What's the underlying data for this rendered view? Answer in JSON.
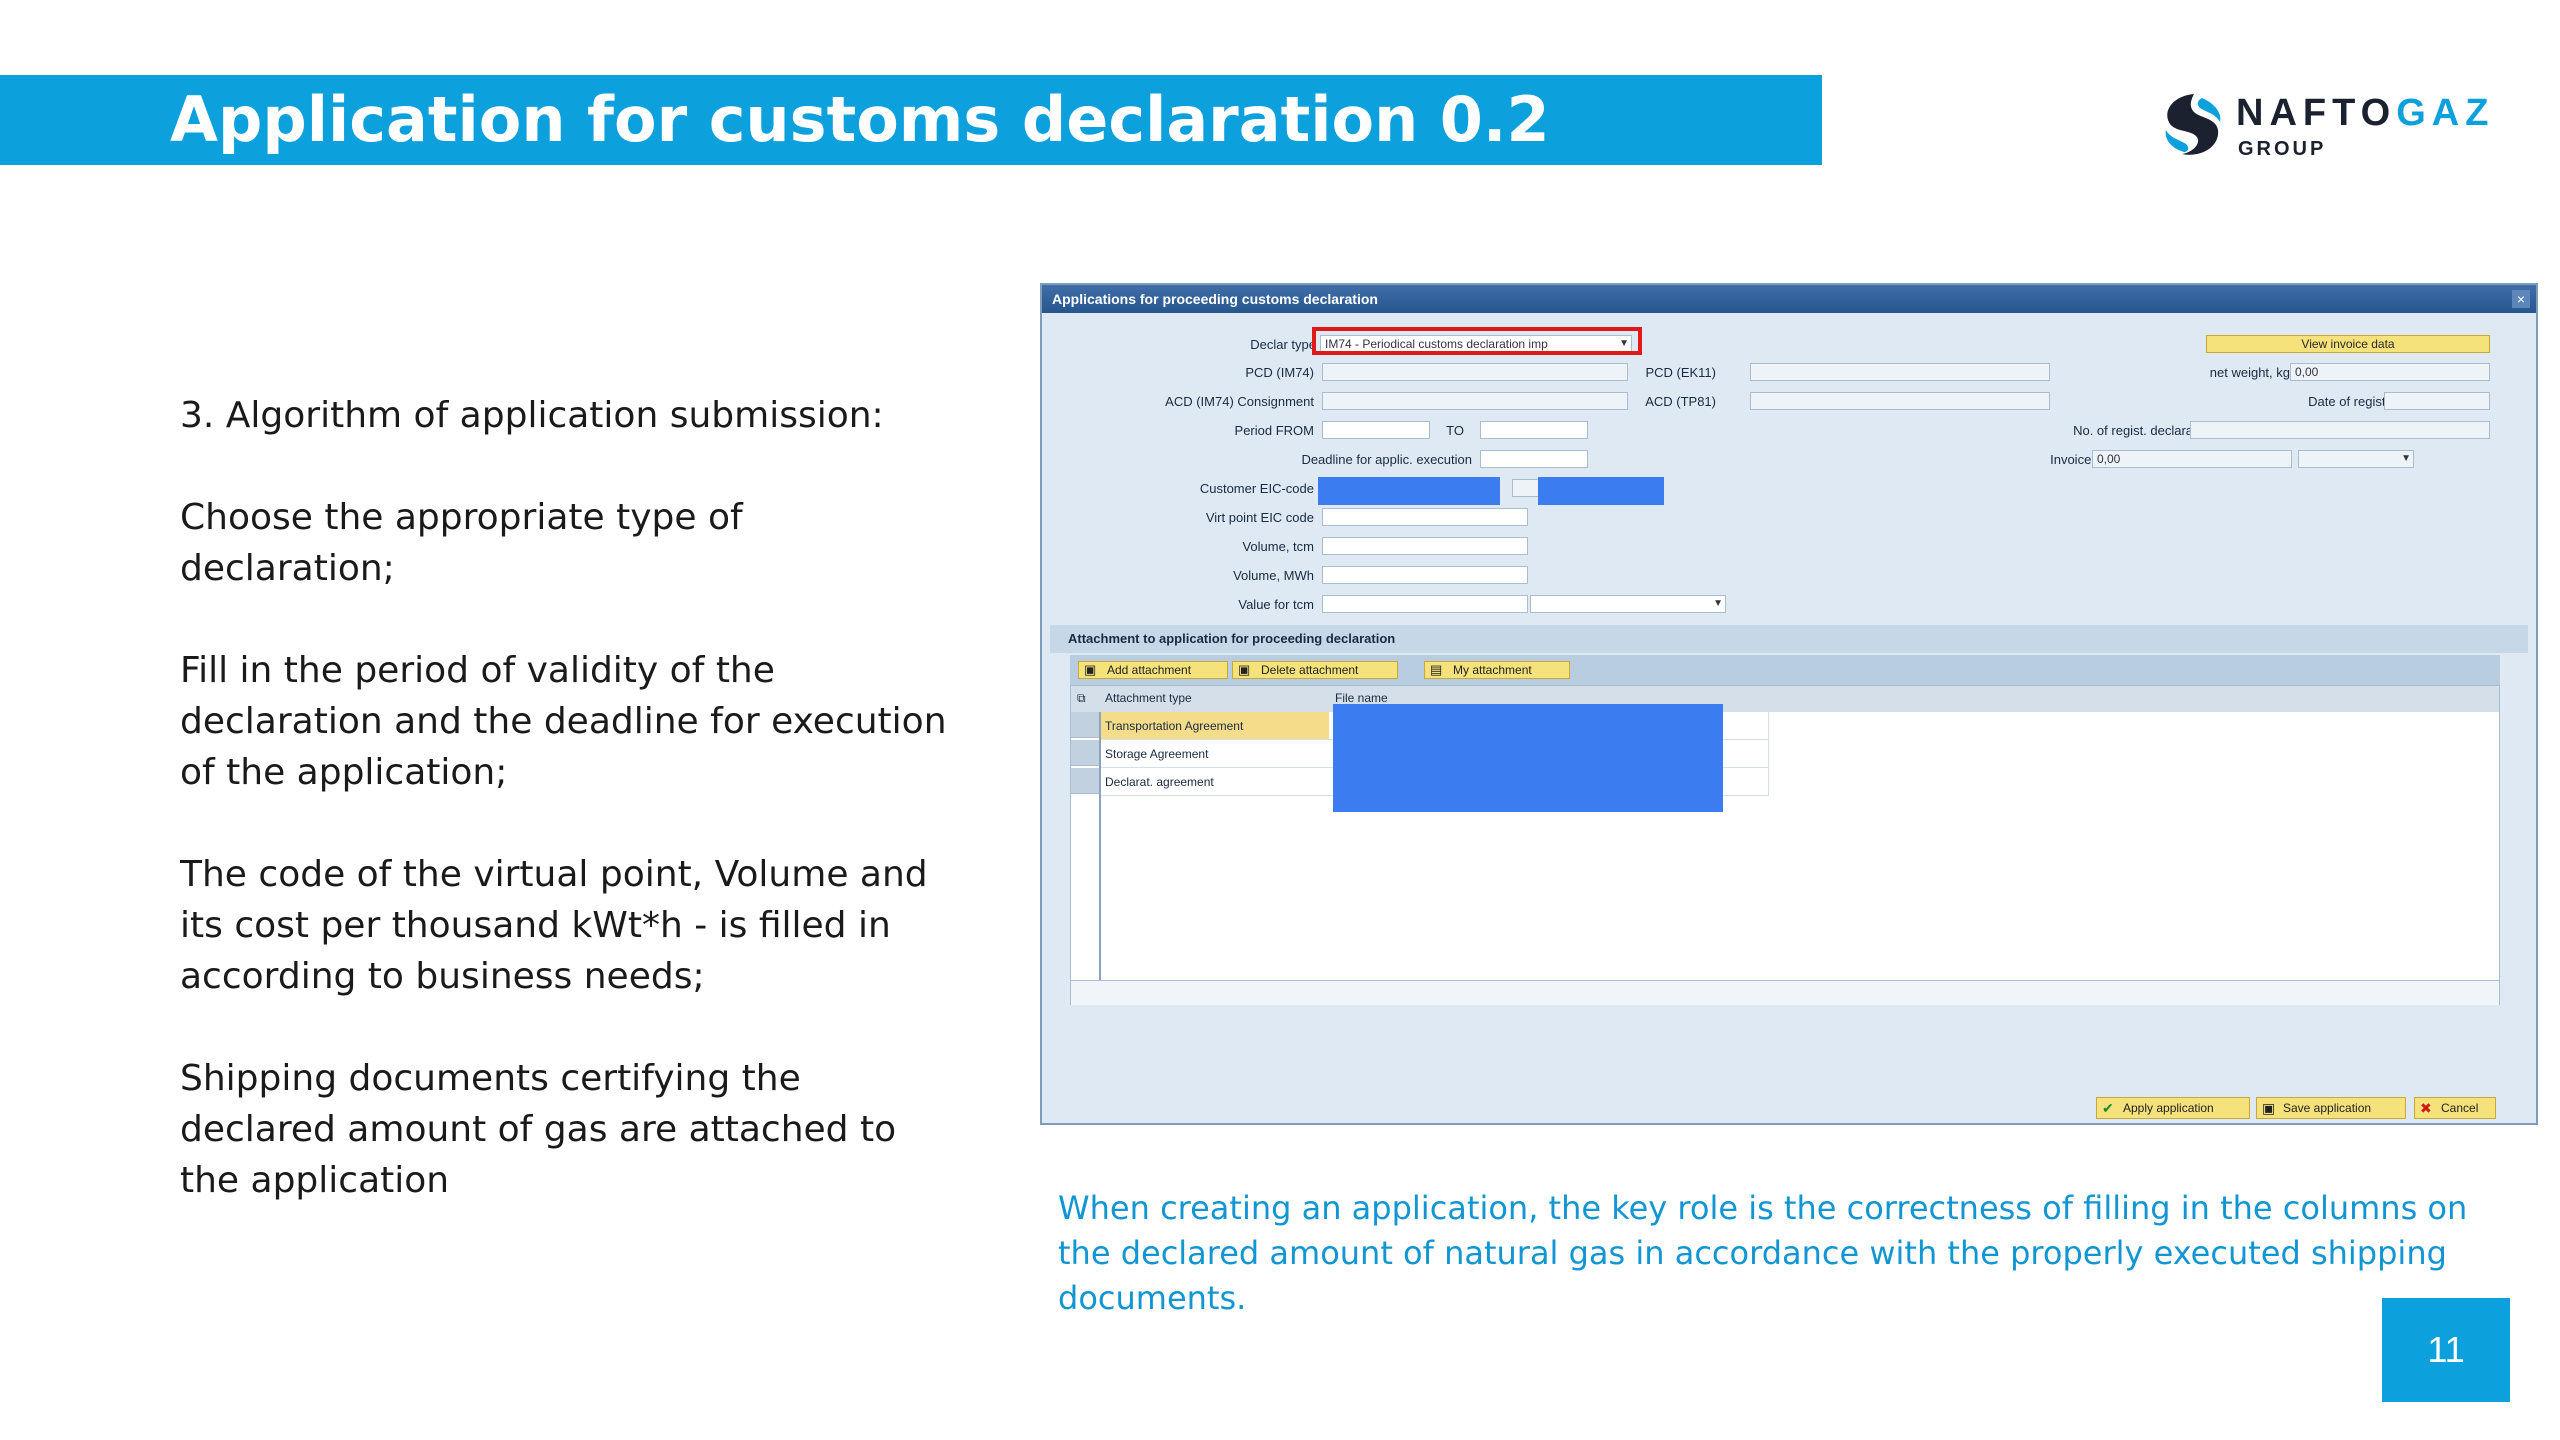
{
  "slide": {
    "title": "Application for customs declaration 0.2",
    "page_number": "11",
    "logo": {
      "word_a": "NAFTO",
      "word_b": "GAZ",
      "sub": "GROUP"
    },
    "left_paragraphs": [
      "3. Algorithm of application submission:",
      "Choose the appropriate type of declaration;",
      "Fill in the period of validity of the declaration and the deadline for execution of the application;",
      "The code of the virtual point, Volume and its cost per thousand kWt*h - is filled in according to business needs;",
      "Shipping documents certifying the declared amount of gas are attached to the application"
    ],
    "caption": "When creating an application, the key role is the correctness of filling in the columns on the declared amount of natural gas in accordance with the properly executed shipping documents.",
    "colors": {
      "accent": "#0ca0dd",
      "caption": "#1196d3",
      "highlight": "#e01818",
      "mask": "#3b7cf0"
    }
  },
  "sap": {
    "window_title": "Applications for proceeding customs declaration",
    "close_icon": "×",
    "fields": {
      "declar_type_label": "Declar type",
      "declar_type_value": "IM74 - Periodical customs declaration imp",
      "pcd_im74_label": "PCD (IM74)",
      "acd_consignment_label": "ACD (IM74) Consignment",
      "period_from_label": "Period FROM",
      "to_label": "TO",
      "deadline_label": "Deadline for applic. execution",
      "customer_eic_label": "Customer EIC-code",
      "virt_point_label": "Virt point EIC code",
      "volume_tcm_label": "Volume, tcm",
      "volume_mwh_label": "Volume, MWh",
      "value_tcm_label": "Value for tcm",
      "pcd_ek11_label": "PCD (EK11)",
      "acd_tp81_label": "ACD (TP81)",
      "net_weight_label": "net weight, kg",
      "net_weight_value": "0,00",
      "date_reg_label": "Date of registration",
      "regist_decl_label": "No. of regist. declaration",
      "invoice_value_label": "Invoice value",
      "invoice_value_value": "0,00",
      "view_invoice_button": "View invoice data"
    },
    "attachment": {
      "section_title": "Attachment to application for proceeding declaration",
      "add_button": "Add attachment",
      "delete_button": "Delete attachment",
      "my_button": "My attachment",
      "col_type": "Attachment type",
      "col_file": "File name",
      "rows": [
        "Transportation Agreement",
        "Storage Agreement",
        "Declarat. agreement"
      ]
    },
    "footer": {
      "apply_button": "Apply application",
      "save_button": "Save application",
      "cancel_button": "Cancel"
    }
  }
}
